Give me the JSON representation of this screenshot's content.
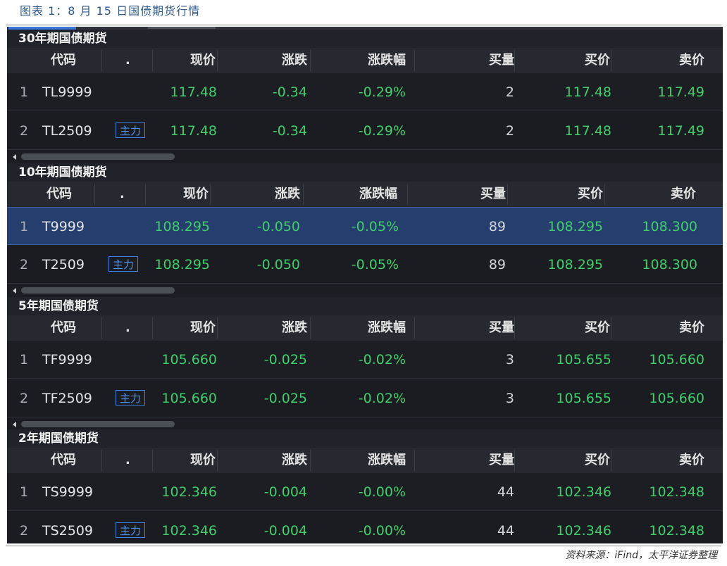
{
  "caption": "图表 1：8 月 15 日国债期货行情",
  "source": "资料来源：iFind，太平洋证券整理",
  "columns": {
    "code": "代码",
    "dot": ".",
    "price": "现价",
    "change": "涨跌",
    "pct": "涨跌幅",
    "volume": "买量",
    "bid": "买价",
    "ask": "卖价"
  },
  "colors": {
    "accent": "#3a76d8",
    "up_down_green": "#3fcf6a",
    "badge_blue": "#4a92f4",
    "panel_bg": "#1b1d22",
    "selected_row": "#263e6e"
  },
  "sections": [
    {
      "title": "30年期国债期货",
      "rows": [
        {
          "idx": "1",
          "code": "TL9999",
          "badge": "",
          "price": "117.48",
          "change": "-0.34",
          "pct": "-0.29%",
          "volume": "2",
          "bid": "117.48",
          "ask": "117.49",
          "selected": false
        },
        {
          "idx": "2",
          "code": "TL2509",
          "badge": "主力",
          "price": "117.48",
          "change": "-0.34",
          "pct": "-0.29%",
          "volume": "2",
          "bid": "117.48",
          "ask": "117.49",
          "selected": false
        }
      ]
    },
    {
      "title": "10年期国债期货",
      "rows": [
        {
          "idx": "1",
          "code": "T9999",
          "badge": "",
          "price": "108.295",
          "change": "-0.050",
          "pct": "-0.05%",
          "volume": "89",
          "bid": "108.295",
          "ask": "108.300",
          "selected": true
        },
        {
          "idx": "2",
          "code": "T2509",
          "badge": "主力",
          "price": "108.295",
          "change": "-0.050",
          "pct": "-0.05%",
          "volume": "89",
          "bid": "108.295",
          "ask": "108.300",
          "selected": false
        }
      ]
    },
    {
      "title": "5年期国债期货",
      "rows": [
        {
          "idx": "1",
          "code": "TF9999",
          "badge": "",
          "price": "105.660",
          "change": "-0.025",
          "pct": "-0.02%",
          "volume": "3",
          "bid": "105.655",
          "ask": "105.660",
          "selected": false
        },
        {
          "idx": "2",
          "code": "TF2509",
          "badge": "主力",
          "price": "105.660",
          "change": "-0.025",
          "pct": "-0.02%",
          "volume": "3",
          "bid": "105.655",
          "ask": "105.660",
          "selected": false
        }
      ]
    },
    {
      "title": "2年期国债期货",
      "rows": [
        {
          "idx": "1",
          "code": "TS9999",
          "badge": "",
          "price": "102.346",
          "change": "-0.004",
          "pct": "-0.00%",
          "volume": "44",
          "bid": "102.346",
          "ask": "102.348",
          "selected": false
        },
        {
          "idx": "2",
          "code": "TS2509",
          "badge": "主力",
          "price": "102.346",
          "change": "-0.004",
          "pct": "-0.00%",
          "volume": "44",
          "bid": "102.346",
          "ask": "102.348",
          "selected": false
        }
      ]
    }
  ]
}
